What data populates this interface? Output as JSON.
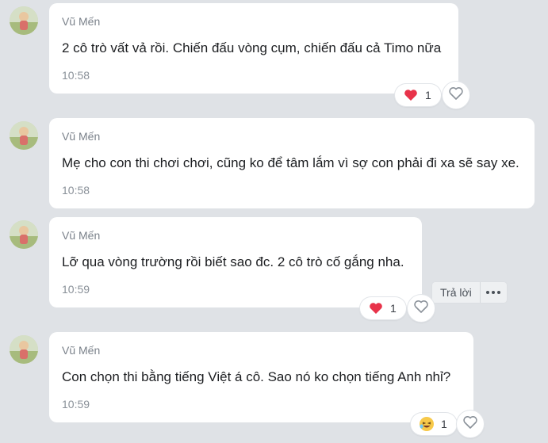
{
  "messages": [
    {
      "sender": "Vũ Mến",
      "text": "2 cô trò vất vả rồi. Chiến đấu vòng cụm, chiến đấu cả Timo nữa",
      "time": "10:58",
      "reaction": {
        "icon": "heart-icon",
        "count": "1"
      }
    },
    {
      "sender": "Vũ Mến",
      "text": "Mẹ cho con thi chơi chơi, cũng ko để tâm lắm vì sợ con phải đi xa sẽ say xe.",
      "time": "10:58"
    },
    {
      "sender": "Vũ Mến",
      "text": "Lỡ qua vòng trường rồi biết sao đc. 2 cô trò cố gắng nha.",
      "time": "10:59",
      "reply_label": "Trả lời",
      "reaction": {
        "icon": "heart-icon",
        "count": "1"
      }
    },
    {
      "sender": "Vũ Mến",
      "text": "Con chọn thi bằng tiếng Việt á cô. Sao nó ko chọn tiếng Anh nhỉ?",
      "time": "10:59",
      "reaction": {
        "icon": "laughing-emoji-icon",
        "count": "1"
      }
    }
  ],
  "colors": {
    "background": "#dfe2e6",
    "bubble": "#ffffff",
    "heart": "#e8334a"
  }
}
